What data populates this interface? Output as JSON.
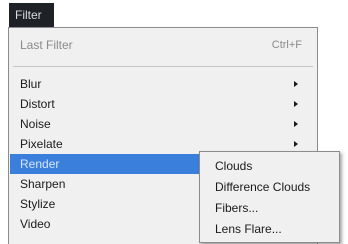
{
  "menubar": {
    "filter_label": "Filter"
  },
  "filter_menu": {
    "last_filter": {
      "label": "Last Filter",
      "shortcut": "Ctrl+F"
    },
    "items": [
      {
        "label": "Blur",
        "has_submenu": true
      },
      {
        "label": "Distort",
        "has_submenu": true
      },
      {
        "label": "Noise",
        "has_submenu": true
      },
      {
        "label": "Pixelate",
        "has_submenu": true
      },
      {
        "label": "Render",
        "has_submenu": true,
        "highlighted": true
      },
      {
        "label": "Sharpen",
        "has_submenu": true
      },
      {
        "label": "Stylize",
        "has_submenu": true
      },
      {
        "label": "Video",
        "has_submenu": true
      }
    ]
  },
  "render_submenu": {
    "items": [
      {
        "label": "Clouds"
      },
      {
        "label": "Difference Clouds"
      },
      {
        "label": "Fibers..."
      },
      {
        "label": "Lens Flare..."
      }
    ]
  },
  "colors": {
    "highlight": "#3b7fdd",
    "menubar_active": "#1e2226",
    "menu_background": "#f0f0f0"
  }
}
